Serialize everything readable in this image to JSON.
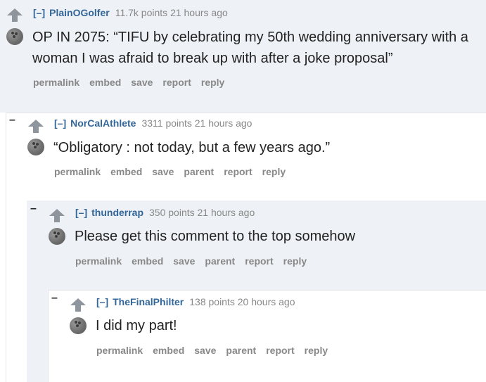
{
  "comments": [
    {
      "author": "PlainOGolfer",
      "toggle": "[–]",
      "points": "11.7k points",
      "time": "21 hours ago",
      "body": "OP IN 2075: “TIFU by celebrating my 50th wedding anniversary with a woman I was afraid to break up with after a joke proposal”",
      "buttons": [
        "permalink",
        "embed",
        "save",
        "report",
        "reply"
      ]
    },
    {
      "author": "NorCalAthlete",
      "toggle": "[–]",
      "points": "3311 points",
      "time": "21 hours ago",
      "body": "“Obligatory : not today, but a few years ago.”",
      "buttons": [
        "permalink",
        "embed",
        "save",
        "parent",
        "report",
        "reply"
      ]
    },
    {
      "author": "thunderrap",
      "toggle": "[–]",
      "points": "350 points",
      "time": "21 hours ago",
      "body": "Please get this comment to the top somehow",
      "buttons": [
        "permalink",
        "embed",
        "save",
        "parent",
        "report",
        "reply"
      ]
    },
    {
      "author": "TheFinalPhilter",
      "toggle": "[–]",
      "points": "138 points",
      "time": "20 hours ago",
      "body": "I did my part!",
      "buttons": [
        "permalink",
        "embed",
        "save",
        "parent",
        "report",
        "reply"
      ]
    }
  ],
  "collapse_symbol": "–",
  "colors": {
    "author": "#336699",
    "meta": "#888888",
    "panel_gray": "#eef1f5"
  }
}
